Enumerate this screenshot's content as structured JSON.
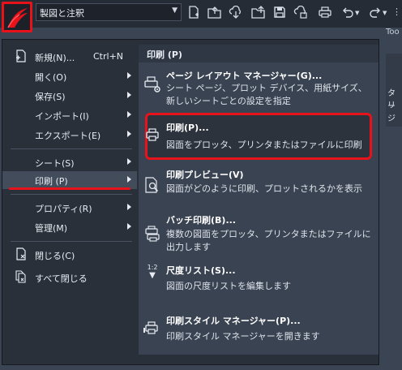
{
  "titlebar": {
    "workspace": "製図と注釈",
    "partial_tab": "Too"
  },
  "icons": {
    "app": "app-logo-icon",
    "new": "new-file-icon",
    "open": "open-folder-icon",
    "cloud": "cloud-open-icon",
    "save_as": "save-as-icon",
    "save": "save-icon",
    "cloud_save": "cloud-save-icon",
    "plot": "plot-icon",
    "undo": "undo-icon",
    "redo": "redo-icon"
  },
  "right_bg": {
    "line1": "タリ",
    "line2": "ージ"
  },
  "left_menu": [
    {
      "label": "新規(N)...",
      "shortcut": "Ctrl+N",
      "arrow": false
    },
    {
      "label": "開く(O)",
      "arrow": true
    },
    {
      "label": "保存(S)",
      "arrow": true
    },
    {
      "label": "インポート(I)",
      "arrow": true
    },
    {
      "label": "エクスポート(E)",
      "arrow": true
    },
    {
      "label": "シート(S)",
      "arrow": true
    },
    {
      "label": "印刷 (P)",
      "arrow": true
    },
    {
      "label": "プロパティ(R)",
      "arrow": true
    },
    {
      "label": "管理(M)",
      "arrow": true
    },
    {
      "label": "閉じる(C)",
      "arrow": false
    },
    {
      "label": "すべて閉じる",
      "arrow": false
    }
  ],
  "submenu": {
    "header": "印刷 (P)",
    "items": [
      {
        "title": "ページ レイアウト マネージャー(G)...",
        "desc": "シート ページ、プロット デバイス、用紙サイズ、新しいシートごとの設定を指定"
      },
      {
        "title": "印刷(P)...",
        "desc": "図面をプロッタ、プリンタまたはファイルに印刷"
      },
      {
        "title": "印刷プレビュー(V)",
        "desc": "図面がどのように印刷、プロットされるかを表示"
      },
      {
        "title": "バッチ印刷(B)...",
        "desc": "複数の図面をプロッタ、プリンタまたはファイルに出力します"
      },
      {
        "title": "尺度リスト(S)...",
        "desc": "図面の尺度リストを編集します",
        "icon_text": "1:2"
      },
      {
        "title": "印刷スタイル マネージャー(P)...",
        "desc": "印刷スタイル マネージャーを開きます"
      }
    ]
  }
}
